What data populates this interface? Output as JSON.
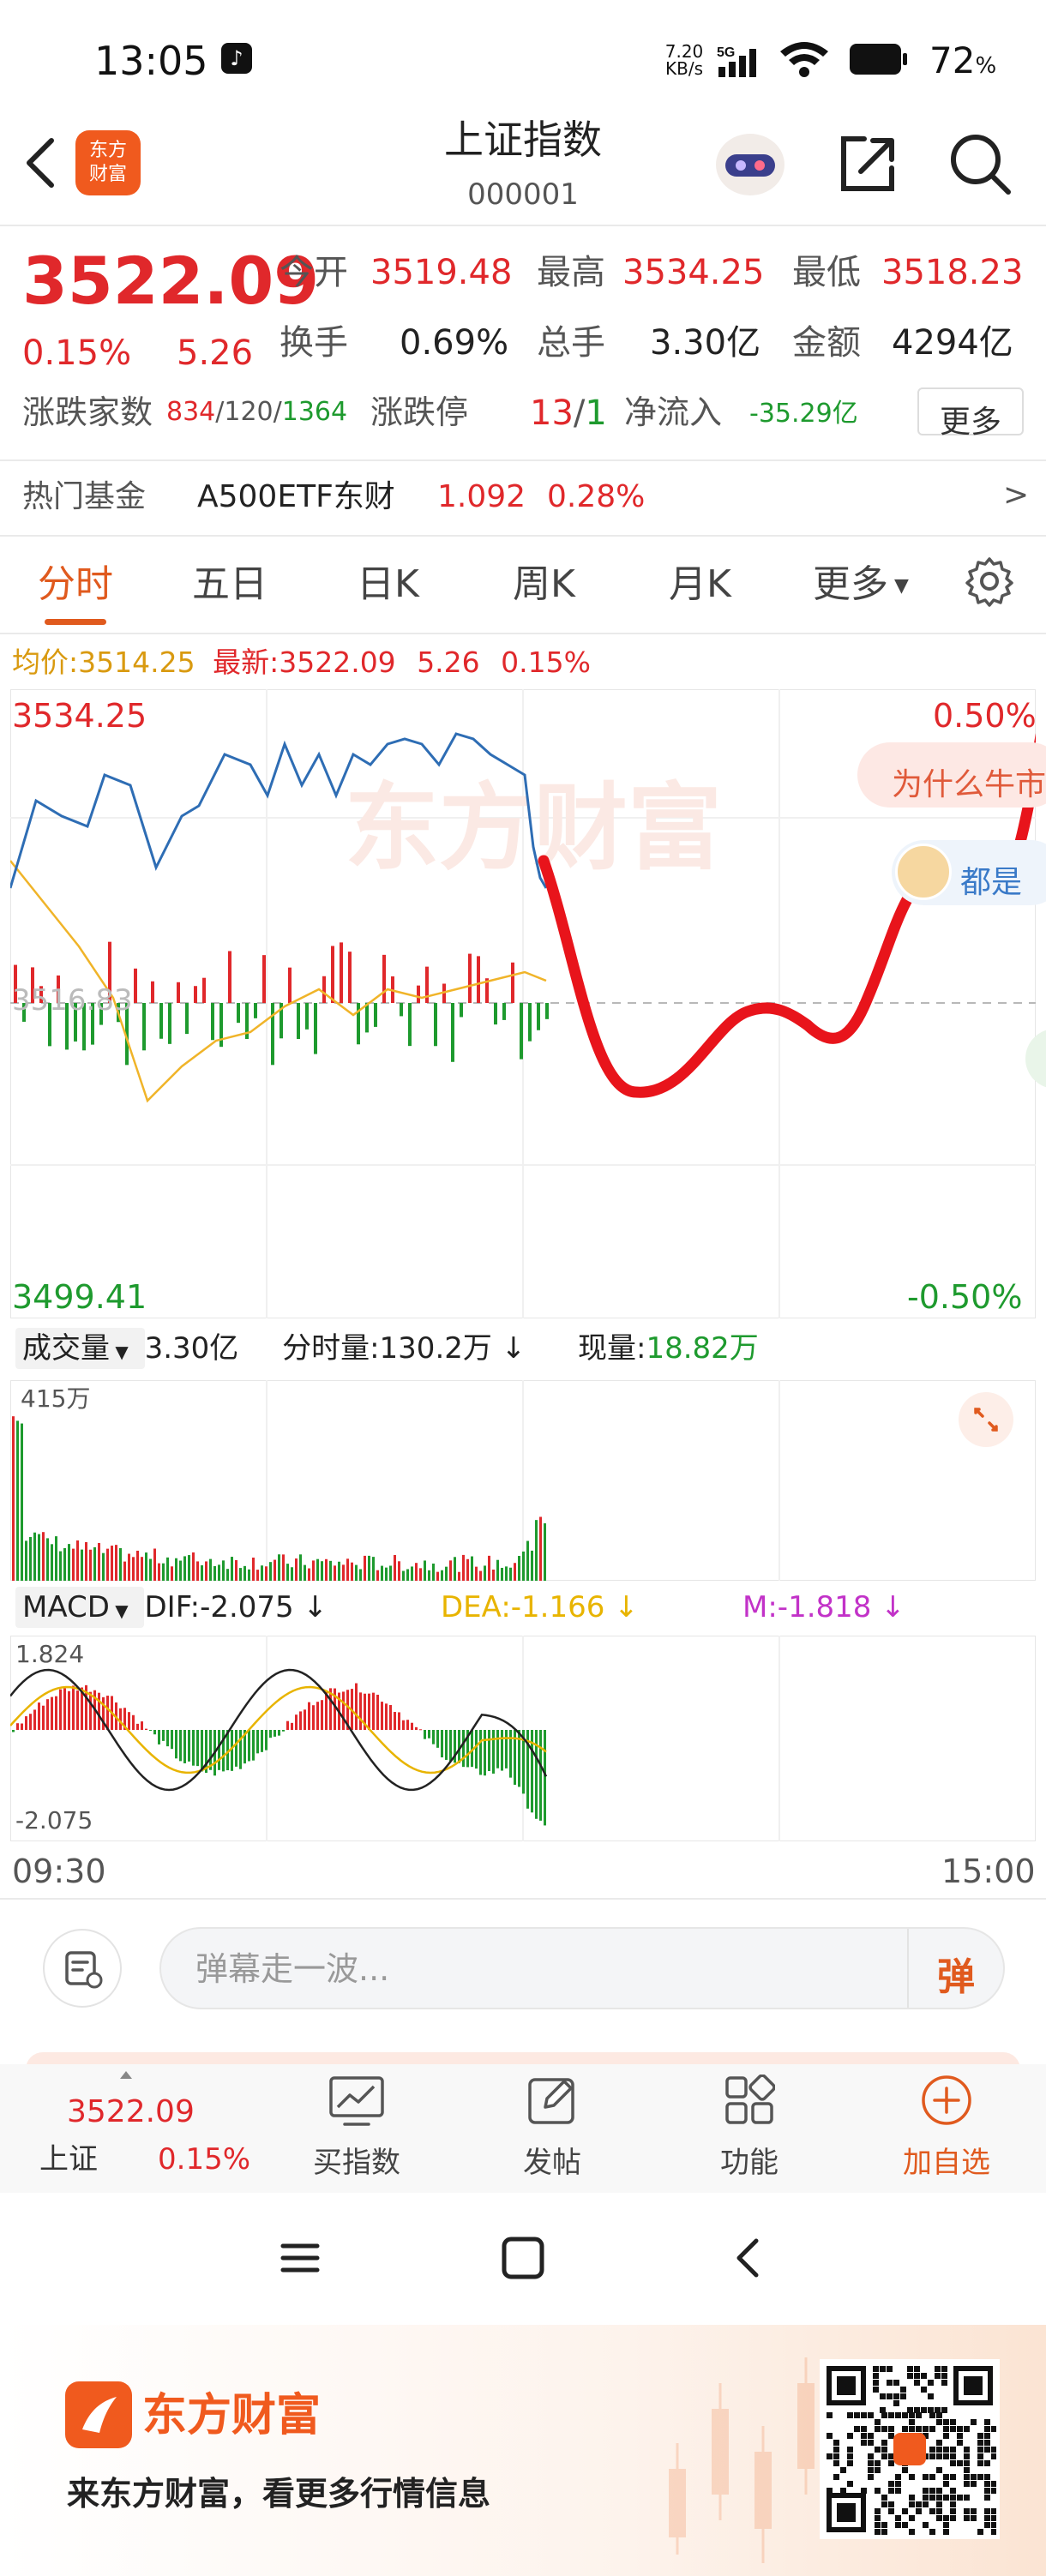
{
  "status_bar": {
    "time": "13:05",
    "net_speed": "7.20\nKB/s",
    "network": "5G",
    "battery": "72",
    "battery_unit": "%"
  },
  "header": {
    "back_icon": "chevron-left-icon",
    "logo_text": "东方\n财富",
    "title": "上证指数",
    "code": "000001",
    "share_icon": "share-icon",
    "search_icon": "search-icon"
  },
  "quote": {
    "price": "3522.09",
    "change_pct": "0.15%",
    "change": "5.26",
    "open_label": "今开",
    "open": "3519.48",
    "high_label": "最高",
    "high": "3534.25",
    "low_label": "最低",
    "low": "3518.23",
    "turnover_label": "换手",
    "turnover": "0.69%",
    "volume_label": "总手",
    "volume": "3.30亿",
    "amount_label": "金额",
    "amount": "4294亿",
    "breadth_label": "涨跌家数",
    "up_count": "834",
    "flat_count": "120",
    "down_count": "1364",
    "limit_label": "涨跌停",
    "limit_up": "13",
    "limit_down": "1",
    "inflow_label": "净流入",
    "inflow": "-35.29亿",
    "more_button": "更多"
  },
  "hot_fund": {
    "label": "热门基金",
    "name": "A500ETF东财",
    "price": "1.092",
    "pct": "0.28%",
    "arrow": ">"
  },
  "tabs": [
    {
      "label": "分时",
      "active": true
    },
    {
      "label": "五日",
      "active": false
    },
    {
      "label": "日K",
      "active": false
    },
    {
      "label": "周K",
      "active": false
    },
    {
      "label": "月K",
      "active": false
    },
    {
      "label": "更多",
      "active": false
    }
  ],
  "info_line": {
    "avg_label": "均价:",
    "avg": "3514.25",
    "latest_label": "最新:",
    "latest": "3522.09",
    "change": "5.26",
    "pct": "0.15%"
  },
  "price_chart": {
    "high_label": "3534.25",
    "low_label": "3499.41",
    "mid_label": "3516.83",
    "high_pct": "0.50%",
    "low_pct": "-0.50%",
    "watermark": "东方财富",
    "danmu_1": "为什么牛市",
    "danmu_2": "都是"
  },
  "volume_panel": {
    "selector": "成交量",
    "total": "3.30亿",
    "tick_label": "分时量:",
    "tick_value": "130.2万",
    "current_label": "现量:",
    "current_value": "18.82万",
    "max_label": "415万"
  },
  "macd_panel": {
    "selector": "MACD",
    "dif_label": "DIF:",
    "dif": "-2.075",
    "dea_label": "DEA:",
    "dea": "-1.166",
    "m_label": "M:",
    "m": "-1.818",
    "top_label": "1.824",
    "bottom_label": "-2.075"
  },
  "time_axis": {
    "start": "09:30",
    "end": "15:00"
  },
  "comment": {
    "placeholder": "弹幕走一波...",
    "danmu_button": "弹"
  },
  "bottom_nav": {
    "index_price": "3522.09",
    "index_name": "上证",
    "index_pct": "0.15%",
    "items": [
      {
        "label": "买指数",
        "icon": "chart-trend-icon"
      },
      {
        "label": "发帖",
        "icon": "edit-icon"
      },
      {
        "label": "功能",
        "icon": "grid-icon"
      },
      {
        "label": "加自选",
        "icon": "plus-circle-icon"
      }
    ]
  },
  "banner": {
    "brand": "东方财富",
    "slogan": "来东方财富，看更多行情信息"
  },
  "colors": {
    "up": "#e0282b",
    "down": "#1e9a2e",
    "accent": "#e05a1e",
    "price_line": "#2e6db4",
    "avg_line": "#f0b429",
    "annotation": "#e8141b"
  }
}
